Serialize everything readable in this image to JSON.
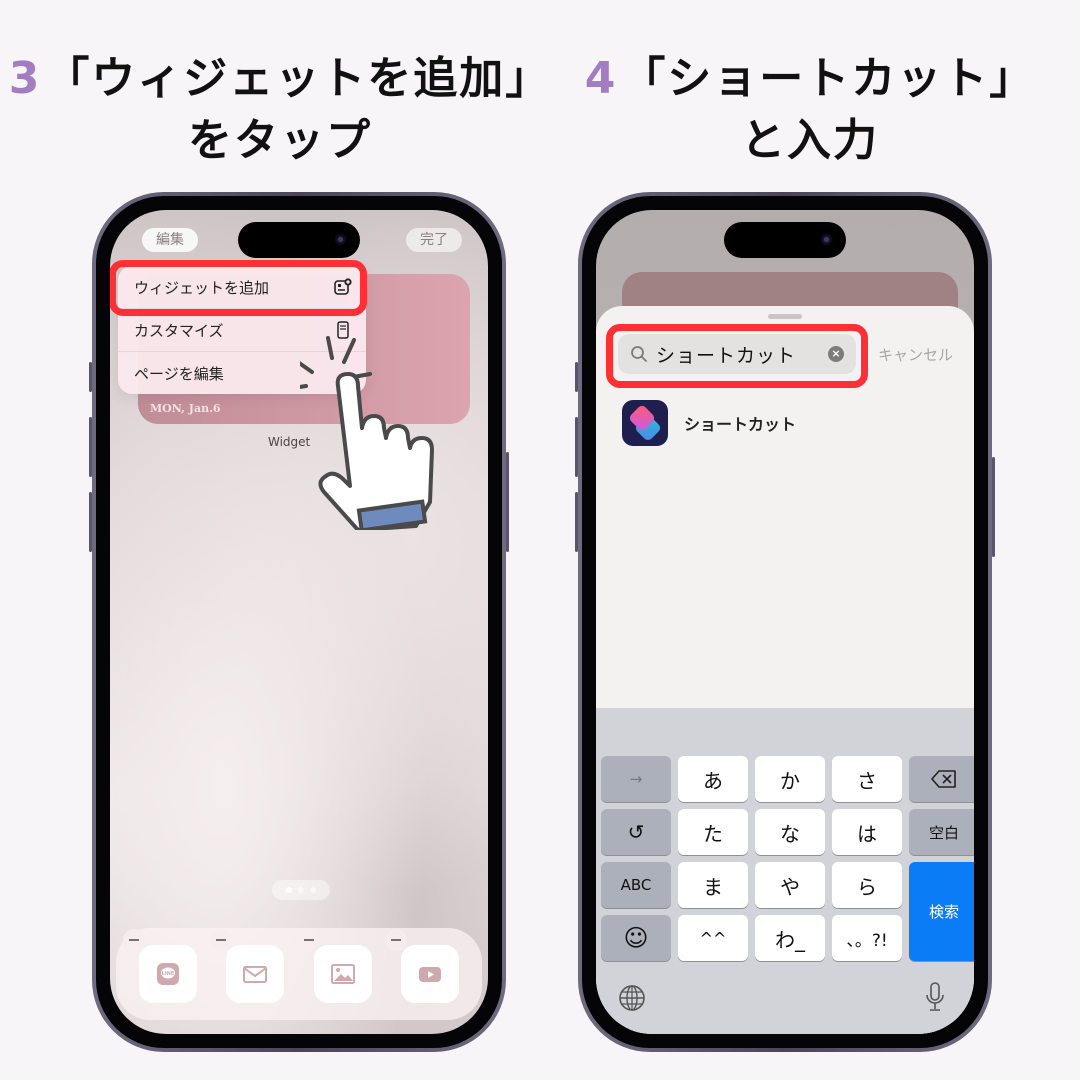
{
  "steps": [
    {
      "number": "3",
      "title_line1": "「ウィジェットを追加」",
      "title_line2": "をタップ"
    },
    {
      "number": "4",
      "title_line1": "「ショートカット」",
      "title_line2": "と入力"
    }
  ],
  "accent_color": "#a37dc2",
  "highlight_color": "#ff3035",
  "left_phone": {
    "top_left_button": "編集",
    "top_right_button": "完了",
    "widget_date": "MON, Jan.6",
    "widget_caption": "Widget",
    "context_menu": [
      {
        "label": "ウィジェットを追加",
        "icon": "add-widget-icon"
      },
      {
        "label": "カスタマイズ",
        "icon": "customize-icon"
      },
      {
        "label": "ページを編集",
        "icon": ""
      }
    ],
    "page_dots": 3,
    "dock_apps": [
      {
        "name": "LINE",
        "icon": "line-icon"
      },
      {
        "name": "Mail",
        "icon": "mail-icon"
      },
      {
        "name": "Photos",
        "icon": "photos-icon"
      },
      {
        "name": "YouTube",
        "icon": "youtube-icon"
      }
    ]
  },
  "right_phone": {
    "search": {
      "value": "ショートカット",
      "clear_icon": "×"
    },
    "cancel_label": "キャンセル",
    "results": [
      {
        "label": "ショートカット",
        "icon": "shortcuts-app-icon"
      }
    ],
    "keyboard": {
      "rows": [
        [
          "→",
          "あ",
          "か",
          "さ",
          "⌫"
        ],
        [
          "↺",
          "た",
          "な",
          "は",
          "空白"
        ],
        [
          "ABC",
          "ま",
          "や",
          "ら"
        ],
        [
          "☺",
          "^^",
          "わ_",
          "、。?!"
        ]
      ],
      "search_key": "検索",
      "search_key_color": "#0a7cf5"
    }
  }
}
